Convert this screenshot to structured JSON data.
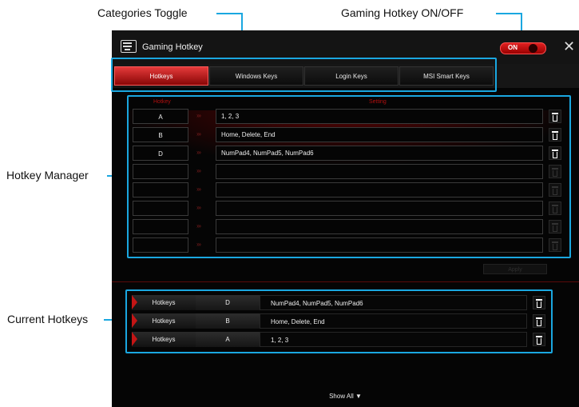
{
  "annotations": {
    "categories_toggle": "Categories Toggle",
    "gaming_hotkey_toggle": "Gaming Hotkey ON/OFF",
    "hotkey_manager": "Hotkey Manager",
    "current_hotkeys": "Current Hotkeys"
  },
  "window": {
    "title": "Gaming Hotkey",
    "toggle_label": "ON",
    "close": "✕"
  },
  "tabs": [
    "Hotkeys",
    "Windows Keys",
    "Login Keys",
    "MSI Smart Keys"
  ],
  "manager": {
    "column_hotkey": "Hotkey",
    "column_setting": "Setting",
    "arrow": "›››",
    "rows": [
      {
        "key": "A",
        "setting": "1, 2, 3",
        "active": true
      },
      {
        "key": "B",
        "setting": "Home, Delete, End",
        "active": true
      },
      {
        "key": "D",
        "setting": "NumPad4, NumPad5, NumPad6",
        "active": true
      },
      {
        "key": "",
        "setting": "",
        "active": false
      },
      {
        "key": "",
        "setting": "",
        "active": false
      },
      {
        "key": "",
        "setting": "",
        "active": false
      },
      {
        "key": "",
        "setting": "",
        "active": false
      },
      {
        "key": "",
        "setting": "",
        "active": false
      }
    ],
    "apply_label": "Apply"
  },
  "current": [
    {
      "category": "Hotkeys",
      "key": "D",
      "setting": "NumPad4, NumPad5, NumPad6"
    },
    {
      "category": "Hotkeys",
      "key": "B",
      "setting": "Home, Delete, End"
    },
    {
      "category": "Hotkeys",
      "key": "A",
      "setting": "1, 2, 3"
    }
  ],
  "show_all_label": "Show All ▼",
  "colors": {
    "accent": "#1aa7e0",
    "brand_red": "#c41515"
  }
}
